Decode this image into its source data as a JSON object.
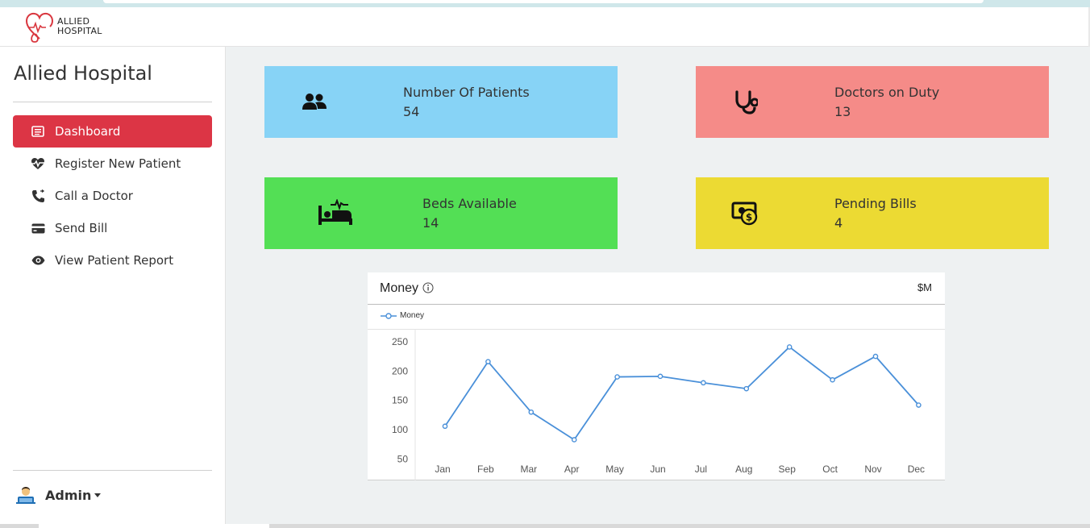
{
  "brand": {
    "line1": "ALLIED",
    "line2": "HOSPITAL"
  },
  "sidebar": {
    "title": "Allied Hospital",
    "items": [
      {
        "label": "Dashboard",
        "icon": "dashboard-icon",
        "active": true
      },
      {
        "label": "Register New Patient",
        "icon": "heartbeat-icon",
        "active": false
      },
      {
        "label": "Call a Doctor",
        "icon": "phone-icon",
        "active": false
      },
      {
        "label": "Send Bill",
        "icon": "credit-card-icon",
        "active": false
      },
      {
        "label": "View Patient Report",
        "icon": "eye-icon",
        "active": false
      }
    ],
    "user": {
      "label": "Admin",
      "icon": "user-avatar-icon"
    }
  },
  "cards": [
    {
      "title": "Number Of Patients",
      "value": "54",
      "color": "#87d3f6",
      "icon": "users-icon"
    },
    {
      "title": "Doctors on Duty",
      "value": "13",
      "color": "#f58b88",
      "icon": "stethoscope-icon"
    },
    {
      "title": "Beds Available",
      "value": "14",
      "color": "#53df55",
      "icon": "hospital-bed-icon"
    },
    {
      "title": "Pending Bills",
      "value": "4",
      "color": "#ecda33",
      "icon": "money-bill-icon"
    }
  ],
  "chart": {
    "title": "Money",
    "unit": "$M",
    "legend": "Money",
    "line_color": "#4a90d9"
  },
  "chart_data": {
    "type": "line",
    "categories": [
      "Jan",
      "Feb",
      "Mar",
      "Apr",
      "May",
      "Jun",
      "Jul",
      "Aug",
      "Sep",
      "Oct",
      "Nov",
      "Dec"
    ],
    "series": [
      {
        "name": "Money",
        "values": [
          106,
          216,
          130,
          83,
          190,
          191,
          180,
          170,
          241,
          185,
          225,
          142
        ]
      }
    ],
    "yticks": [
      250,
      200,
      150,
      100,
      50
    ],
    "ylim": [
      40,
      260
    ],
    "grid": false,
    "legend_position": "top-left"
  }
}
